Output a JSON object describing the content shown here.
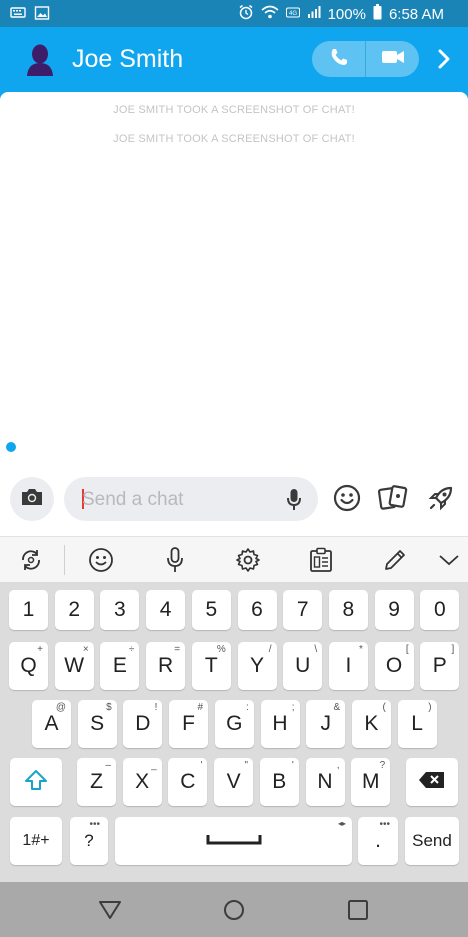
{
  "status_bar": {
    "battery_percent": "100%",
    "time": "6:58 AM"
  },
  "header": {
    "contact_name": "Joe Smith"
  },
  "chat": {
    "system_messages": [
      "JOE SMITH TOOK A SCREENSHOT OF CHAT!",
      "JOE SMITH TOOK A SCREENSHOT OF CHAT!"
    ]
  },
  "input": {
    "placeholder": "Send a chat",
    "value": ""
  },
  "keyboard": {
    "row_numbers": [
      "1",
      "2",
      "3",
      "4",
      "5",
      "6",
      "7",
      "8",
      "9",
      "0"
    ],
    "row1": [
      {
        "label": "Q",
        "hint": "+"
      },
      {
        "label": "W",
        "hint": "×"
      },
      {
        "label": "E",
        "hint": "÷"
      },
      {
        "label": "R",
        "hint": "="
      },
      {
        "label": "T",
        "hint": "%"
      },
      {
        "label": "Y",
        "hint": "/"
      },
      {
        "label": "U",
        "hint": "\\"
      },
      {
        "label": "I",
        "hint": "*"
      },
      {
        "label": "O",
        "hint": "["
      },
      {
        "label": "P",
        "hint": "]"
      }
    ],
    "row2": [
      {
        "label": "A",
        "hint": "@"
      },
      {
        "label": "S",
        "hint": "$"
      },
      {
        "label": "D",
        "hint": "!"
      },
      {
        "label": "F",
        "hint": "#"
      },
      {
        "label": "G",
        "hint": ":"
      },
      {
        "label": "H",
        "hint": ";"
      },
      {
        "label": "J",
        "hint": "&"
      },
      {
        "label": "K",
        "hint": "("
      },
      {
        "label": "L",
        "hint": ")"
      }
    ],
    "row3": [
      {
        "label": "Z",
        "hint": "–"
      },
      {
        "label": "X",
        "hint": "_"
      },
      {
        "label": "C",
        "hint": "'"
      },
      {
        "label": "V",
        "hint": "\""
      },
      {
        "label": "B",
        "hint": "'"
      },
      {
        "label": "N",
        "hint": ","
      },
      {
        "label": "M",
        "hint": "?"
      }
    ],
    "symbols_key": "1#+",
    "question_key": "?",
    "period_key": ".",
    "send_key": "Send"
  },
  "colors": {
    "brand_blue": "#0fa6ef",
    "status_bar": "#1a84b6",
    "keyboard_bg": "#dcdcdc",
    "nav_bar": "#a9a9a9"
  }
}
